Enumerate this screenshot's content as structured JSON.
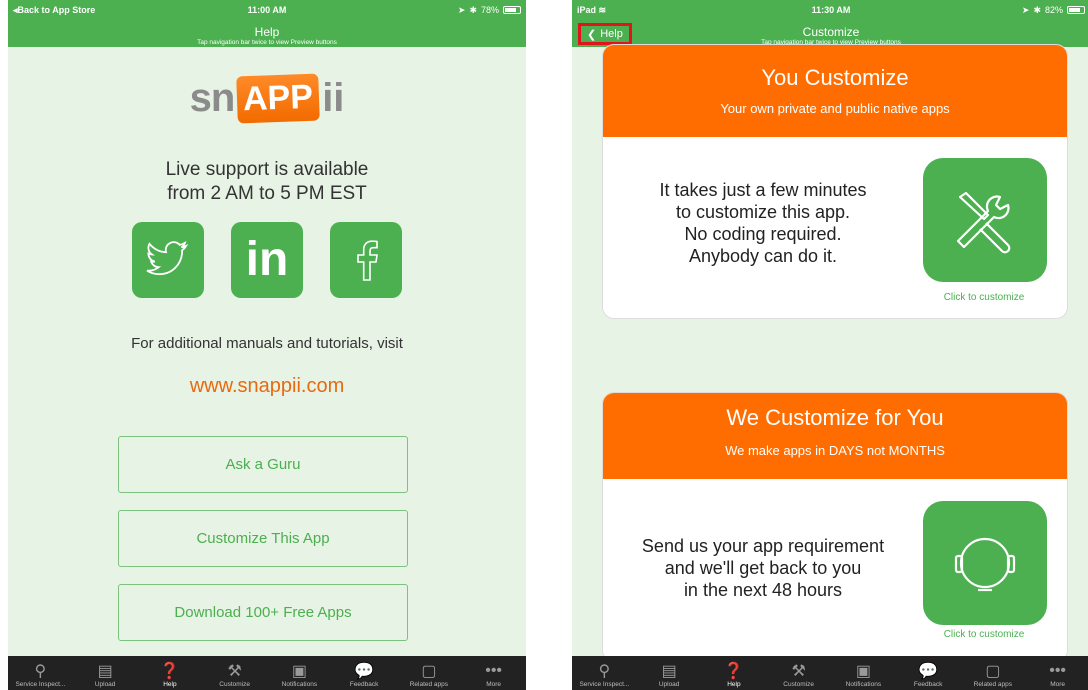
{
  "screen1": {
    "status": {
      "left": "Back to App Store",
      "time": "11:00 AM",
      "battery": "78%",
      "battery_level": 0.78
    },
    "nav": {
      "title": "Help",
      "subtitle": "Tap navigation bar twice to view Preview buttons"
    },
    "logo": {
      "part1": "sn",
      "part2": "APP",
      "part3": "ii"
    },
    "support_line1": "Live support is available",
    "support_line2": "from 2 AM to 5 PM EST",
    "social": [
      {
        "name": "twitter",
        "glyph": "🐦"
      },
      {
        "name": "linkedin",
        "glyph": "in"
      },
      {
        "name": "facebook",
        "glyph": "f"
      }
    ],
    "manuals_text": "For additional manuals and tutorials, visit",
    "website": "www.snappii.com",
    "buttons": [
      "Ask a Guru",
      "Customize This App",
      "Download 100+ Free Apps"
    ]
  },
  "screen2": {
    "status": {
      "left": "iPad",
      "time": "11:30 AM",
      "battery": "82%",
      "battery_level": 0.82
    },
    "nav": {
      "back_label": "Help",
      "title": "Customize",
      "subtitle": "Tap navigation bar twice to view Preview buttons"
    },
    "card1": {
      "title": "You Customize",
      "subtitle": "Your own private and public native apps",
      "lines": [
        "It takes just a few minutes",
        "to customize this app.",
        "No coding required.",
        "Anybody can do it."
      ],
      "link": "Click to customize"
    },
    "card2": {
      "title": "We Customize for You",
      "subtitle": "We make apps in DAYS not MONTHS",
      "lines": [
        "Send us your app requirement",
        "and we'll get back to you",
        "in the next 48 hours"
      ],
      "link": "Click to customize"
    }
  },
  "tabbar": [
    {
      "label": "Service Inspect...",
      "icon": "search-icon"
    },
    {
      "label": "Upload",
      "icon": "pdf-icon"
    },
    {
      "label": "Help",
      "icon": "help-icon",
      "active": true
    },
    {
      "label": "Customize",
      "icon": "tools-icon"
    },
    {
      "label": "Notifications",
      "icon": "notification-icon"
    },
    {
      "label": "Feedback",
      "icon": "feedback-icon"
    },
    {
      "label": "Related apps",
      "icon": "apps-icon"
    },
    {
      "label": "More",
      "icon": "more-icon"
    }
  ],
  "colors": {
    "green": "#4caf50",
    "orange": "#ff6d00",
    "bg": "#e7f3e4",
    "link_orange": "#e86a10",
    "highlight": "#e0141a"
  }
}
